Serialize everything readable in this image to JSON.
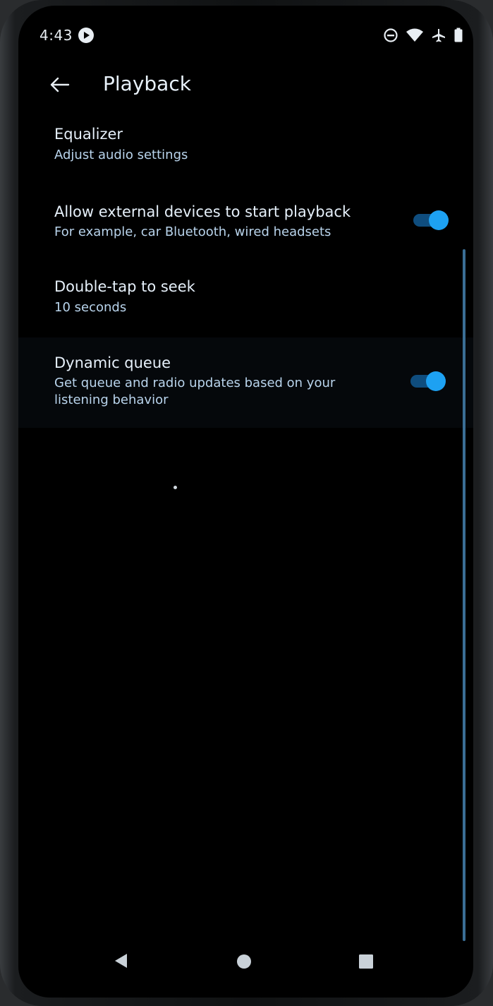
{
  "status_bar": {
    "time": "4:43",
    "icons": [
      "media-app-icon",
      "do-not-disturb-icon",
      "wifi-icon",
      "airplane-mode-icon",
      "battery-icon"
    ]
  },
  "header": {
    "title": "Playback",
    "back_icon": "arrow-back-icon"
  },
  "settings": [
    {
      "title": "Equalizer",
      "subtitle": "Adjust audio settings",
      "has_toggle": false
    },
    {
      "title": "Allow external devices to start playback",
      "subtitle": "For example, car Bluetooth, wired headsets",
      "has_toggle": true,
      "toggle_on": true
    },
    {
      "title": "Double-tap to seek",
      "subtitle": "10 seconds",
      "has_toggle": false
    },
    {
      "title": "Dynamic queue",
      "subtitle": "Get queue and radio updates based on your listening behavior",
      "has_toggle": true,
      "toggle_on": true
    }
  ],
  "nav_bar": {
    "icons": [
      "nav-back-icon",
      "nav-home-icon",
      "nav-recents-icon"
    ]
  },
  "colors": {
    "background": "#000000",
    "accent": "#1da1f2",
    "toggle_track": "#0f4d7e",
    "text_primary": "#e6f0fa",
    "text_secondary": "#b9d4ec"
  }
}
